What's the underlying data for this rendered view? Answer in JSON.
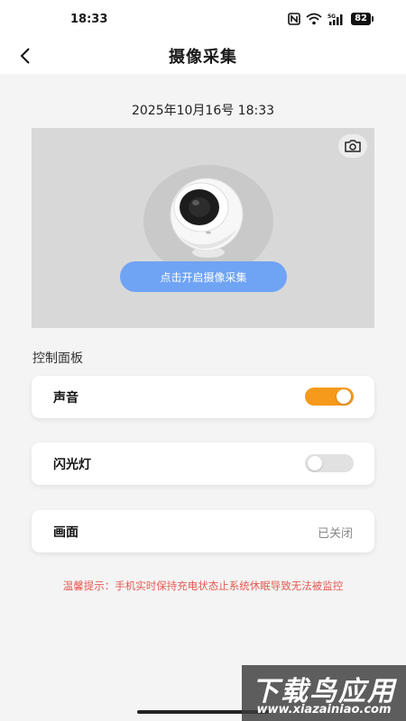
{
  "status_bar": {
    "time": "18:33",
    "battery": "82",
    "icons": [
      "nfc-icon",
      "wifi-icon",
      "signal-5g-icon",
      "battery-icon"
    ]
  },
  "nav": {
    "title": "摄像采集",
    "back_icon": "chevron-left-icon"
  },
  "timestamp": "2025年10月16号 18:33",
  "preview": {
    "start_button_label": "点击开启摄像采集",
    "snapshot_icon": "camera-icon",
    "background": "#d8d8d8"
  },
  "control_panel": {
    "title": "控制面板",
    "items": [
      {
        "label": "声音",
        "type": "toggle",
        "state": "on"
      },
      {
        "label": "闪光灯",
        "type": "toggle",
        "state": "off"
      },
      {
        "label": "画面",
        "type": "status",
        "status": "已关闭"
      }
    ]
  },
  "hint": "温馨提示：手机实时保持充电状态止系统休眠导致无法被监控",
  "watermark": {
    "title": "下载鸟应用",
    "url": "www.xiazainiao.com"
  },
  "colors": {
    "accent": "#f59a1b",
    "button_blue": "#6fa3f4",
    "hint_red": "#e35b52"
  }
}
